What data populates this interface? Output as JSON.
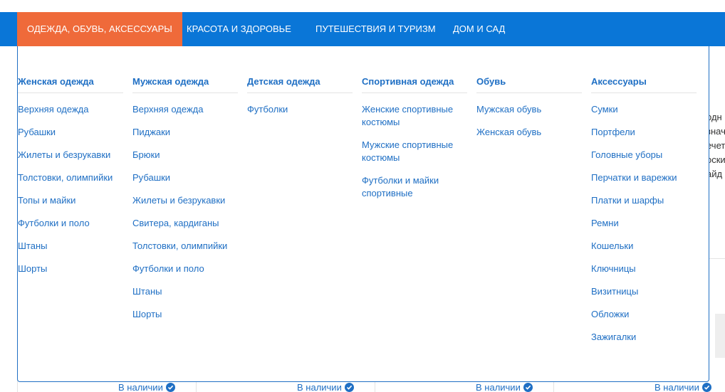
{
  "nav": {
    "items": [
      {
        "label": "ОДЕЖДА, ОБУВЬ, АКСЕССУАРЫ"
      },
      {
        "label": "КРАСОТА И ЗДОРОВЬЕ"
      },
      {
        "label": "ПУТЕШЕСТВИЯ И ТУРИЗМ"
      },
      {
        "label": "ДОМ И САД"
      }
    ]
  },
  "menu": {
    "columns": [
      {
        "title": "Женская одежда",
        "links": [
          "Верхняя одежда",
          "Рубашки",
          "Жилеты и безрукавки",
          "Толстовки, олимпийки",
          "Топы и майки",
          "Футболки и поло",
          "Штаны",
          "Шорты"
        ]
      },
      {
        "title": "Мужская одежда",
        "links": [
          "Верхняя одежда",
          "Пиджаки",
          "Брюки",
          "Рубашки",
          "Жилеты и безрукавки",
          "Свитера, кардиганы",
          "Толстовки, олимпийки",
          "Футболки и поло",
          "Штаны",
          "Шорты"
        ]
      },
      {
        "title": "Детская одежда",
        "links": [
          "Футболки"
        ]
      },
      {
        "title": "Спортивная одежда",
        "links": [
          "Женские спортивные костюмы",
          "Мужские спортивные костюмы",
          "Футболки и майки спортивные"
        ]
      },
      {
        "title": "Обувь",
        "links": [
          "Мужская обувь",
          "Женская обувь"
        ]
      },
      {
        "title": "Аксессуары",
        "links": [
          "Сумки",
          "Портфели",
          "Головные уборы",
          "Перчатки и варежки",
          "Платки и шарфы",
          "Ремни",
          "Кошельки",
          "Ключницы",
          "Визитницы",
          "Обложки",
          "Зажигалки"
        ]
      }
    ]
  },
  "background": {
    "right_fragments": [
      "одн",
      "знач",
      "ечет",
      "оски",
      "айд"
    ],
    "stock_label": "В наличии"
  },
  "colors": {
    "nav_bg": "#0a76d7",
    "nav_active": "#ef6a3a",
    "link": "#1f6fc4"
  }
}
